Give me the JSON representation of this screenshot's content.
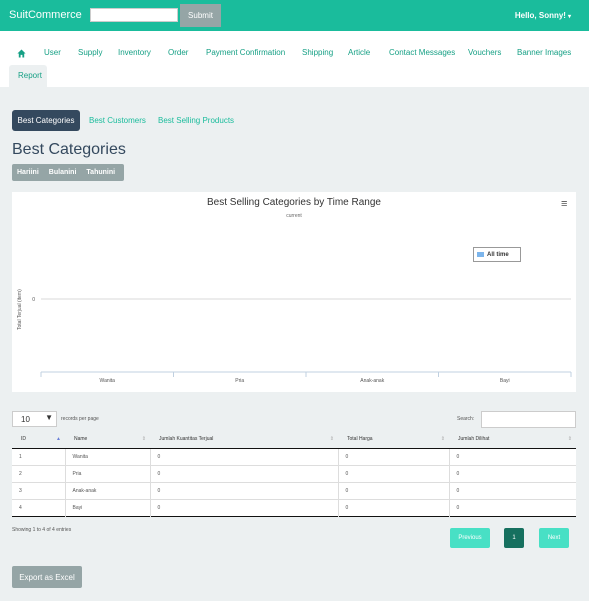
{
  "header": {
    "brand": "SuitCommerce",
    "search_value": "",
    "submit_label": "Submit",
    "user_greeting": "Hello, Sonny!"
  },
  "nav": {
    "items": [
      "User",
      "Supply",
      "Inventory",
      "Order",
      "Payment Confirmation",
      "Shipping",
      "Article",
      "Contact Messages",
      "Vouchers",
      "Banner Images",
      "Report"
    ],
    "active": "Report"
  },
  "tabs": [
    "Best Categories",
    "Best Customers",
    "Best Selling Products"
  ],
  "page_title": "Best Categories",
  "range_buttons": [
    "Hariini",
    "Bulanini",
    "Tahunini"
  ],
  "chart_data": {
    "type": "bar",
    "title": "Best Selling Categories by Time Range",
    "subtitle": "current",
    "ylabel": "Total Terjual (item)",
    "categories": [
      "Wanita",
      "Pria",
      "Anak-anak",
      "Bayi"
    ],
    "series": [
      {
        "name": "All time",
        "values": [
          0,
          0,
          0,
          0
        ]
      }
    ],
    "y_ticks": [
      "0"
    ],
    "legend_position": "top-right"
  },
  "table": {
    "length_value": "10",
    "length_label": "records per page",
    "search_label": "Search:",
    "columns": [
      "ID",
      "Name",
      "Jumlah Kuantitas Terjual",
      "Total Harga",
      "Jumlah Dilihat"
    ],
    "rows": [
      [
        "1",
        "Wanita",
        "0",
        "0",
        "0"
      ],
      [
        "2",
        "Pria",
        "0",
        "0",
        "0"
      ],
      [
        "3",
        "Anak-anak",
        "0",
        "0",
        "0"
      ],
      [
        "4",
        "Bayi",
        "0",
        "0",
        "0"
      ]
    ],
    "info": "Showing 1 to 4 of 4 entries"
  },
  "pagination": {
    "previous": "Previous",
    "page": "1",
    "next": "Next"
  },
  "export_label": "Export as Excel",
  "colors": {
    "accent": "#1abc9c",
    "dark": "#34495e",
    "gray": "#95a5a6",
    "page_bg": "#ecf0f1",
    "series": "#7cb5ec"
  }
}
